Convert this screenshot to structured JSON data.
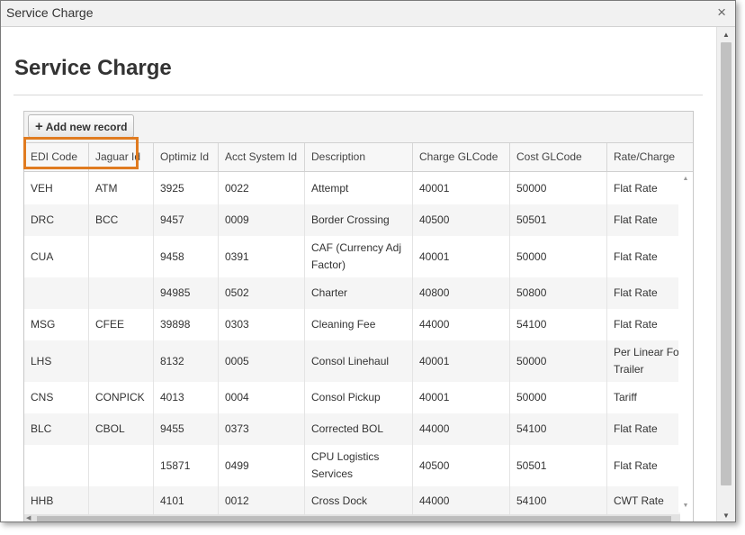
{
  "window": {
    "title": "Service Charge",
    "close_symbol": "×"
  },
  "page": {
    "heading": "Service Charge"
  },
  "toolbar": {
    "add_label": "Add new record",
    "add_icon": "+"
  },
  "accent_color": "#e07b20",
  "columns": [
    "EDI Code",
    "Jaguar Id",
    "Optimiz Id",
    "Acct System Id",
    "Description",
    "Charge GLCode",
    "Cost GLCode",
    "Rate/Charge"
  ],
  "rows": [
    [
      "VEH",
      "ATM",
      "3925",
      "0022",
      "Attempt",
      "40001",
      "50000",
      "Flat Rate"
    ],
    [
      "DRC",
      "BCC",
      "9457",
      "0009",
      "Border Crossing",
      "40500",
      "50501",
      "Flat Rate"
    ],
    [
      "CUA",
      "",
      "9458",
      "0391",
      "CAF (Currency Adj\nFactor)",
      "40001",
      "50000",
      "Flat Rate"
    ],
    [
      "",
      "",
      "94985",
      "0502",
      "Charter",
      "40800",
      "50800",
      "Flat Rate"
    ],
    [
      "MSG",
      "CFEE",
      "39898",
      "0303",
      "Cleaning Fee",
      "44000",
      "54100",
      "Flat Rate"
    ],
    [
      "LHS",
      "",
      "8132",
      "0005",
      "Consol Linehaul",
      "40001",
      "50000",
      "Per Linear Fo\nTrailer"
    ],
    [
      "CNS",
      "CONPICK",
      "4013",
      "0004",
      "Consol Pickup",
      "40001",
      "50000",
      "Tariff"
    ],
    [
      "BLC",
      "CBOL",
      "9455",
      "0373",
      "Corrected BOL",
      "44000",
      "54100",
      "Flat Rate"
    ],
    [
      "",
      "",
      "15871",
      "0499",
      "CPU Logistics\nServices",
      "40500",
      "50501",
      "Flat Rate"
    ],
    [
      "HHB",
      "",
      "4101",
      "0012",
      "Cross Dock",
      "44000",
      "54100",
      "CWT Rate"
    ]
  ]
}
